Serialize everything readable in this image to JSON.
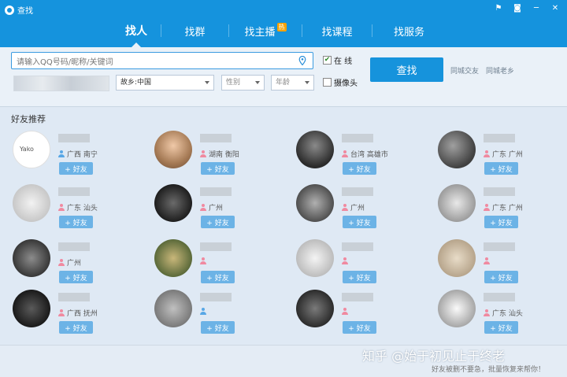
{
  "window": {
    "title": "查找"
  },
  "window_controls": [
    "flag",
    "skin",
    "minimize",
    "close"
  ],
  "tabs": [
    {
      "label": "找人",
      "active": true
    },
    {
      "label": "找群"
    },
    {
      "label": "找主播",
      "badge": "热"
    },
    {
      "label": "找课程"
    },
    {
      "label": "找服务"
    }
  ],
  "search": {
    "placeholder": "请输入QQ号码/昵称/关键词",
    "online_label": "在 线",
    "online_checked": true,
    "camera_label": "摄像头",
    "camera_checked": false,
    "hometown": "故乡:中国",
    "gender": "性别",
    "age": "年龄",
    "button": "查找",
    "link1": "同城交友",
    "link2": "同城老乡"
  },
  "recommend": {
    "title": "好友推荐",
    "add_label": "+ 好友",
    "friends": [
      {
        "location": "广西 南宁",
        "gender": "m",
        "avatar_text": "Yako"
      },
      {
        "location": "湖南 衡阳",
        "gender": "f"
      },
      {
        "location": "台湾 高雄市",
        "gender": "f"
      },
      {
        "location": "广东 广州",
        "gender": "f"
      },
      {
        "location": "广东 汕头",
        "gender": "f"
      },
      {
        "location": "广州",
        "gender": "f"
      },
      {
        "location": "广州",
        "gender": "f"
      },
      {
        "location": "广东 广州",
        "gender": "f"
      },
      {
        "location": "广州",
        "gender": "f"
      },
      {
        "location": "",
        "gender": "f"
      },
      {
        "location": "",
        "gender": "f"
      },
      {
        "location": "",
        "gender": "f"
      },
      {
        "location": "广西 抚州",
        "gender": "f"
      },
      {
        "location": "",
        "gender": "m"
      },
      {
        "location": "",
        "gender": "f"
      },
      {
        "location": "广东 汕头",
        "gender": "f"
      }
    ]
  },
  "watermark": "知乎 @始于初见止于终老",
  "footnote": "好友被删不要急，批量恢复来帮你！"
}
